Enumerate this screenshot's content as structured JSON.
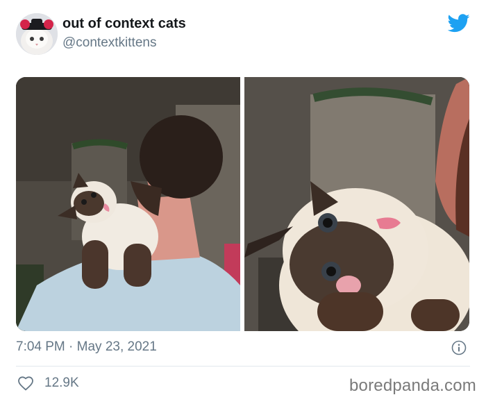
{
  "user": {
    "display_name": "out of context cats",
    "handle": "@contextkittens"
  },
  "tweet": {
    "timestamp": "7:04 PM · May 23, 2021",
    "likes": "12.9K"
  },
  "watermark": "boredpanda.com",
  "icons": {
    "brand": "twitter-bird-icon",
    "info": "info-icon",
    "like": "heart-icon"
  },
  "colors": {
    "twitter_blue": "#1da1f2",
    "secondary_text": "#657786",
    "primary_text": "#14171a",
    "divider": "#e1e8ed"
  }
}
